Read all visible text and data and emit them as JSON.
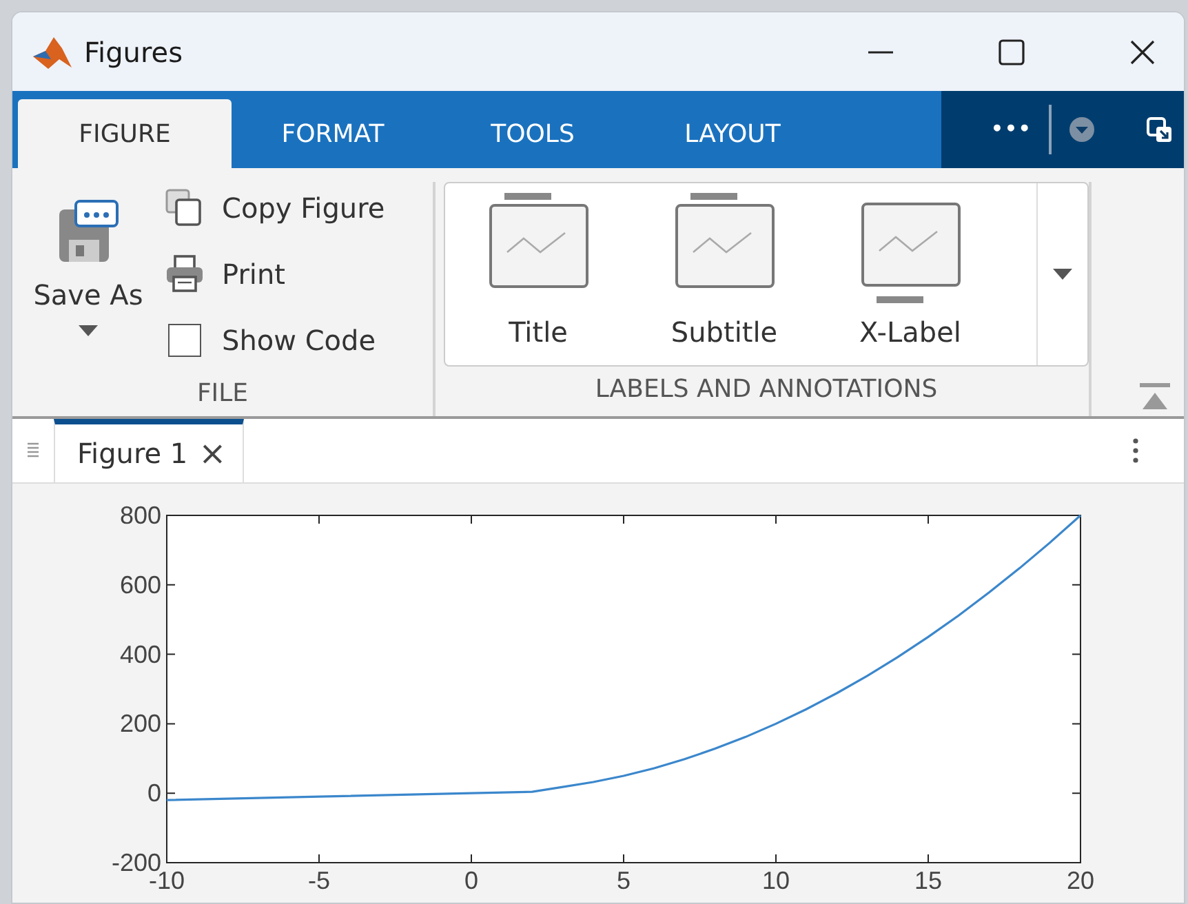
{
  "window": {
    "title": "Figures"
  },
  "tabs": [
    {
      "label": "FIGURE",
      "selected": true
    },
    {
      "label": "FORMAT",
      "selected": false
    },
    {
      "label": "TOOLS",
      "selected": false
    },
    {
      "label": "LAYOUT",
      "selected": false
    }
  ],
  "overflow_button": "•••",
  "file_section": {
    "label": "FILE",
    "save_as": "Save As",
    "items": [
      {
        "kind": "copy",
        "label": "Copy Figure"
      },
      {
        "kind": "print",
        "label": "Print"
      },
      {
        "kind": "checkbox",
        "label": "Show Code",
        "checked": false
      }
    ]
  },
  "labels_section": {
    "label": "LABELS AND ANNOTATIONS",
    "items": [
      {
        "kind": "top",
        "label": "Title"
      },
      {
        "kind": "top",
        "label": "Subtitle"
      },
      {
        "kind": "bottom",
        "label": "X-Label"
      }
    ]
  },
  "document_tabs": [
    {
      "label": "Figure 1",
      "selected": true,
      "close": "×"
    }
  ],
  "chart_data": {
    "type": "line",
    "x": [
      -10,
      -5,
      0,
      2,
      3,
      4,
      5,
      6,
      7,
      8,
      9,
      10,
      11,
      12,
      13,
      14,
      15,
      16,
      17,
      18,
      19,
      20
    ],
    "series": [
      {
        "color": "#3b87cc",
        "values": [
          -20,
          -10,
          0,
          4,
          18,
          32,
          50,
          72,
          98,
          128,
          162,
          200,
          242,
          288,
          338,
          392,
          450,
          512,
          578,
          648,
          722,
          800
        ]
      }
    ],
    "xlim": [
      -10,
      20
    ],
    "ylim": [
      -200,
      800
    ],
    "xticks": [
      -10,
      -5,
      0,
      5,
      10,
      15,
      20
    ],
    "yticks": [
      -200,
      0,
      200,
      400,
      600,
      800
    ]
  }
}
